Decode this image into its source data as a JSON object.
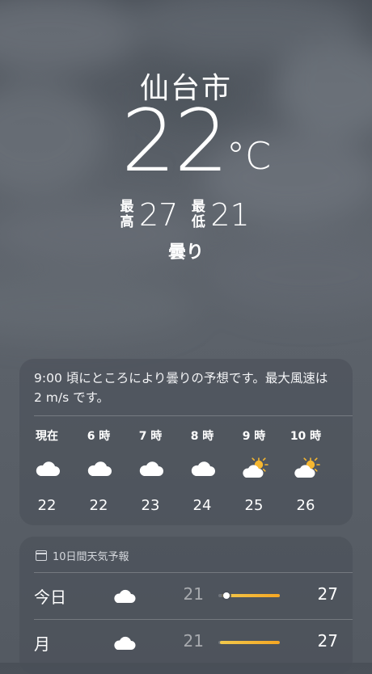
{
  "location": {
    "city": "仙台市",
    "temperature": "22",
    "unit": "°C",
    "high_label": "最高",
    "high": "27",
    "low_label": "最低",
    "low": "21",
    "condition": "曇り"
  },
  "hourly": {
    "summary": "9:00 頃にところにより曇りの予想です。最大風速は 2 m/s です。",
    "items": [
      {
        "label": "現在",
        "icon": "cloud-icon",
        "temp": "22"
      },
      {
        "label": "6 時",
        "icon": "cloud-icon",
        "temp": "22"
      },
      {
        "label": "7 時",
        "icon": "cloud-icon",
        "temp": "23"
      },
      {
        "label": "8 時",
        "icon": "cloud-icon",
        "temp": "24"
      },
      {
        "label": "9 時",
        "icon": "partly-sunny-icon",
        "temp": "25"
      },
      {
        "label": "10 時",
        "icon": "partly-sunny-icon",
        "temp": "26"
      }
    ]
  },
  "daily": {
    "header": "10日間天気予報",
    "items": [
      {
        "day": "今日",
        "icon": "cloud-icon",
        "low": "21",
        "high": "27"
      },
      {
        "day": "月",
        "icon": "cloud-icon",
        "low": "21",
        "high": "27"
      }
    ]
  },
  "colors": {
    "sun": "#f5b731",
    "bar": "#f5a623",
    "background": "#5b6169"
  }
}
